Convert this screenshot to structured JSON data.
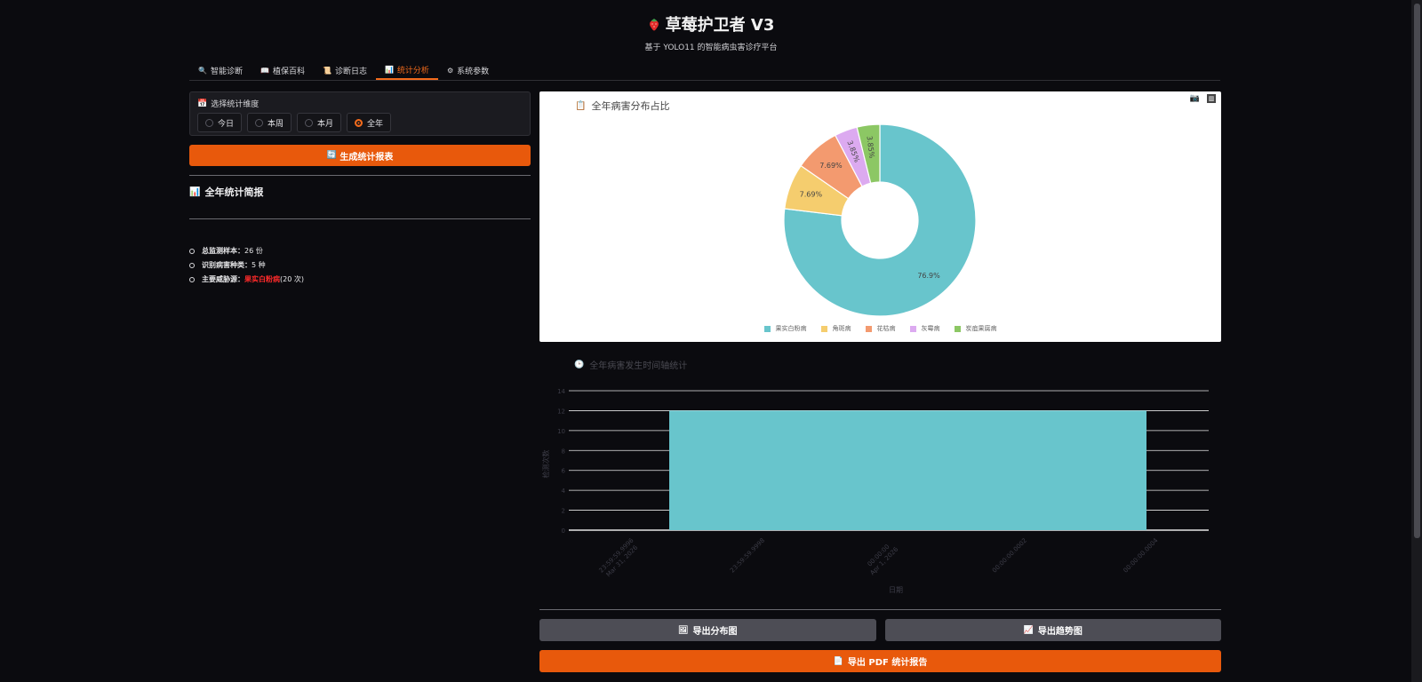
{
  "header": {
    "icon": "strawberry-icon",
    "title": "草莓护卫者 V3",
    "subtitle": "基于 YOLO11 的智能病虫害诊疗平台"
  },
  "tabs": [
    {
      "label": "智能诊断",
      "icon": "magnifier-icon",
      "active": false
    },
    {
      "label": "植保百科",
      "icon": "book-icon",
      "active": false
    },
    {
      "label": "诊断日志",
      "icon": "scroll-icon",
      "active": false
    },
    {
      "label": "统计分析",
      "icon": "bar-chart-icon",
      "active": true
    },
    {
      "label": "系统参数",
      "icon": "gear-icon",
      "active": false
    }
  ],
  "left": {
    "dim_label": "选择统计维度",
    "options": [
      "今日",
      "本周",
      "本月",
      "全年"
    ],
    "selected": "全年",
    "generate_button": "生成统计报表",
    "brief_title": "全年统计简报",
    "stats": [
      {
        "label": "总监测样本：",
        "value": "26 份"
      },
      {
        "label": "识别病害种类：",
        "value": "5 种"
      },
      {
        "label": "主要威胁源：",
        "value_red": "果实白粉病",
        "value": " (20 次)"
      }
    ]
  },
  "pie_panel": {
    "title": "全年病害分布占比"
  },
  "bar_panel": {
    "title": "全年病害发生时间轴统计"
  },
  "actions": {
    "export_dist": "导出分布图",
    "export_trend": "导出趋势图",
    "export_pdf": "导出 PDF 统计报告"
  },
  "colors": {
    "accent": "#e8590c",
    "teal": "#68c5cc",
    "yellow": "#f5cd6e",
    "salmon": "#f39a6f",
    "lilac": "#dcaaf0",
    "green": "#8cc764"
  },
  "chart_data": [
    {
      "type": "pie",
      "title": "全年病害分布占比",
      "categories": [
        "果实白粉病",
        "角斑病",
        "花枯病",
        "灰霉病",
        "炭疽果腐病"
      ],
      "values": [
        20,
        2,
        2,
        1,
        1
      ],
      "labels": [
        "76.9%",
        "7.69%",
        "7.69%",
        "3.85%",
        "3.85%"
      ],
      "colors": [
        "#68c5cc",
        "#f5cd6e",
        "#f39a6f",
        "#dcaaf0",
        "#8cc764"
      ],
      "legend": "bottom"
    },
    {
      "type": "bar",
      "title": "全年病害发生时间轴统计",
      "xlabel": "日期",
      "ylabel": "检测次数",
      "x_ticks": [
        "23:59:59.9996\nMar 31, 2026",
        "23:59:59.9998",
        "00:00:00\nApr 1, 2026",
        "00:00:00.0002",
        "00:00:00.0004"
      ],
      "y_ticks": [
        0,
        2,
        4,
        6,
        8,
        10,
        12,
        14
      ],
      "ylim": [
        0,
        14
      ],
      "bars": [
        {
          "x": "Apr 1, 2026",
          "value": 12
        }
      ],
      "grid": true
    }
  ]
}
